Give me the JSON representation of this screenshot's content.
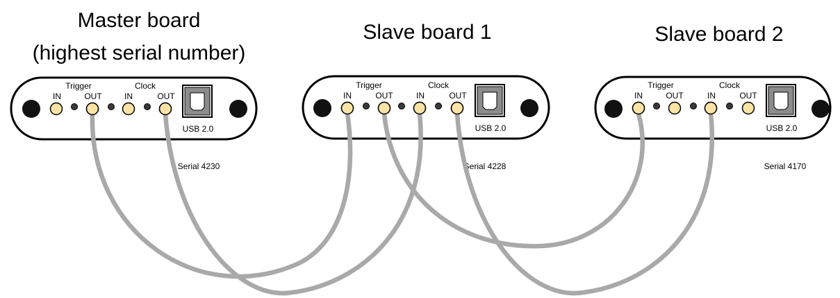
{
  "colors": {
    "panel_fill": "#ffffff",
    "panel_stroke": "#000000",
    "connector_fill": "#fbe3a6",
    "led_fill": "#3a3a3a",
    "screw_fill": "#111111",
    "cable": "#a9a9a9",
    "usb_fill": "#8c8c8c"
  },
  "boards": [
    {
      "title_lines": [
        "Master board",
        "(highest serial number)"
      ],
      "trigger_label": "Trigger",
      "clock_label": "Clock",
      "trigger_in": "IN",
      "trigger_out": "OUT",
      "clock_in": "IN",
      "clock_out": "OUT",
      "usb_label": "USB 2.0",
      "serial": "Serial 4230"
    },
    {
      "title_lines": [
        "Slave board 1"
      ],
      "trigger_label": "Trigger",
      "clock_label": "Clock",
      "trigger_in": "IN",
      "trigger_out": "OUT",
      "clock_in": "IN",
      "clock_out": "OUT",
      "usb_label": "USB 2.0",
      "serial": "Serial 4228"
    },
    {
      "title_lines": [
        "Slave board 2"
      ],
      "trigger_label": "Trigger",
      "clock_label": "Clock",
      "trigger_in": "IN",
      "trigger_out": "OUT",
      "clock_in": "IN",
      "clock_out": "OUT",
      "usb_label": "USB 2.0",
      "serial": "Serial 4170"
    }
  ],
  "connections": [
    {
      "from": "Master board Trigger OUT",
      "to": "Slave board 1 Trigger IN"
    },
    {
      "from": "Master board Clock OUT",
      "to": "Slave board 1 Clock IN"
    },
    {
      "from": "Slave board 1 Trigger OUT",
      "to": "Slave board 2 Trigger IN"
    },
    {
      "from": "Slave board 1 Clock OUT",
      "to": "Slave board 2 Clock IN"
    }
  ]
}
